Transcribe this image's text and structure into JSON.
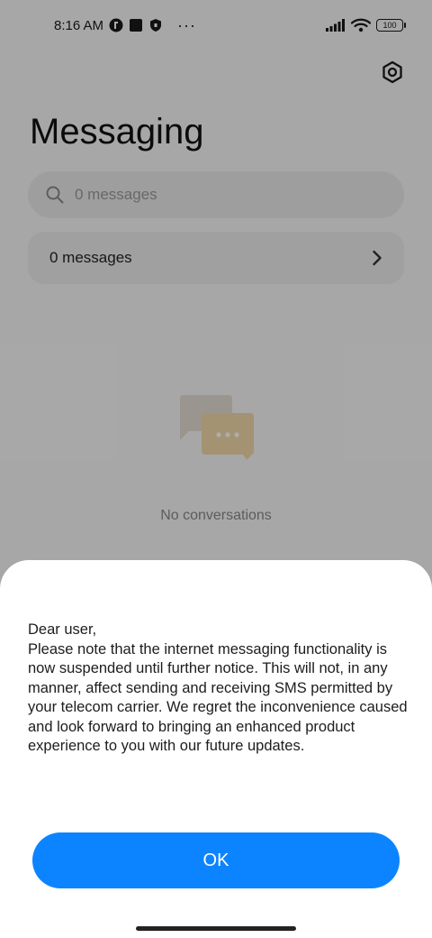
{
  "status_bar": {
    "time": "8:16 AM",
    "more": "···",
    "battery": "100",
    "icons": [
      "brand-icon",
      "square-icon",
      "shield-icon",
      "signal-icon",
      "wifi-icon",
      "battery-icon"
    ]
  },
  "header": {
    "title": "Messaging",
    "settings_icon": "settings-icon"
  },
  "search": {
    "placeholder": "0 messages",
    "icon": "search-icon"
  },
  "messages_row": {
    "label": "0 messages",
    "icon": "chevron-right-icon"
  },
  "empty_state": {
    "icon": "chat-bubbles-icon",
    "text": "No conversations"
  },
  "dialog": {
    "line1": "Dear user,",
    "body": "Please note that the internet messaging functionality is now suspended until further notice. This will not, in any manner, affect sending and receiving SMS permitted by your telecom carrier. We regret the inconvenience caused and look forward to bringing an enhanced product experience to you with our future updates.",
    "ok_label": "OK"
  },
  "colors": {
    "accent": "#0d84ff",
    "scrim": "rgba(0,0,0,0.32)"
  }
}
